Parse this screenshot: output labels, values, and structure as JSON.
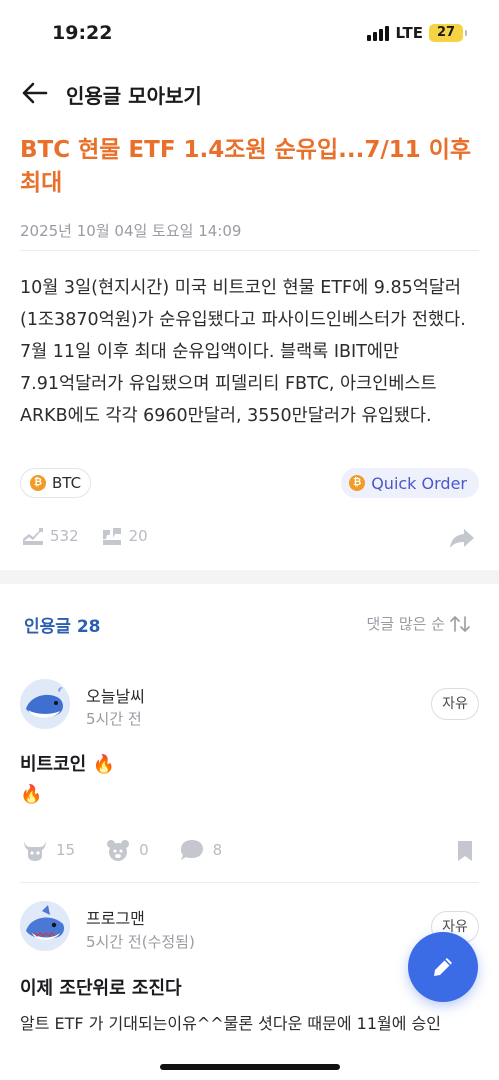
{
  "status_bar": {
    "time": "19:22",
    "network": "LTE",
    "battery": "27"
  },
  "header": {
    "title": "인용글 모아보기"
  },
  "article": {
    "title": "BTC 현물 ETF 1.4조원 순유입...7/11 이후 최대",
    "date": "2025년 10월 04일 토요일 14:09",
    "body": "10월 3일(현지시간) 미국 비트코인 현물 ETF에 9.85억달러(1조3870억원)가 순유입됐다고 파사이드인베스터가 전했다. 7월 11일 이후 최대 순유입액이다. 블랙록 IBIT에만 7.91억달러가 유입됐으며 피델리티 FBTC, 아크인베스트 ARKB에도 각각 6960만달러, 3550만달러가 유입됐다.",
    "ticker_chip": "BTC",
    "quick_order": "Quick Order",
    "stats": {
      "trend": "532",
      "quotes": "20"
    }
  },
  "quotes": {
    "header": "인용글 28",
    "sort_label": "댓글 많은 순"
  },
  "posts": [
    {
      "author": "오늘날씨",
      "time": "5시간 전",
      "tag": "자유",
      "title": "비트코인 🔥",
      "line2": "🔥",
      "reactions": {
        "bull": "15",
        "bear": "0",
        "comments": "8"
      }
    },
    {
      "author": "프로그맨",
      "time": "5시간 전(수정됨)",
      "tag": "자유",
      "title": "이제 조단위로 조진다",
      "body": "알트 ETF 가 기대되는이유^^물론 셧다운 때문에 11월에 승인"
    }
  ],
  "colors": {
    "accent_orange": "#e8702a",
    "link_blue": "#2c5fb0",
    "fab_blue": "#3c6be6",
    "coin_orange": "#f29b26",
    "battery_yellow": "#f6d343"
  },
  "icons": {
    "back": "arrow-left-icon",
    "trend": "trend-chart-icon",
    "quote": "quote-icon",
    "share": "share-icon",
    "sort": "sort-arrows-icon",
    "bull": "bull-icon",
    "bear": "bear-icon",
    "comment": "comment-bubble-icon",
    "bookmark": "bookmark-icon",
    "write": "pencil-icon"
  }
}
